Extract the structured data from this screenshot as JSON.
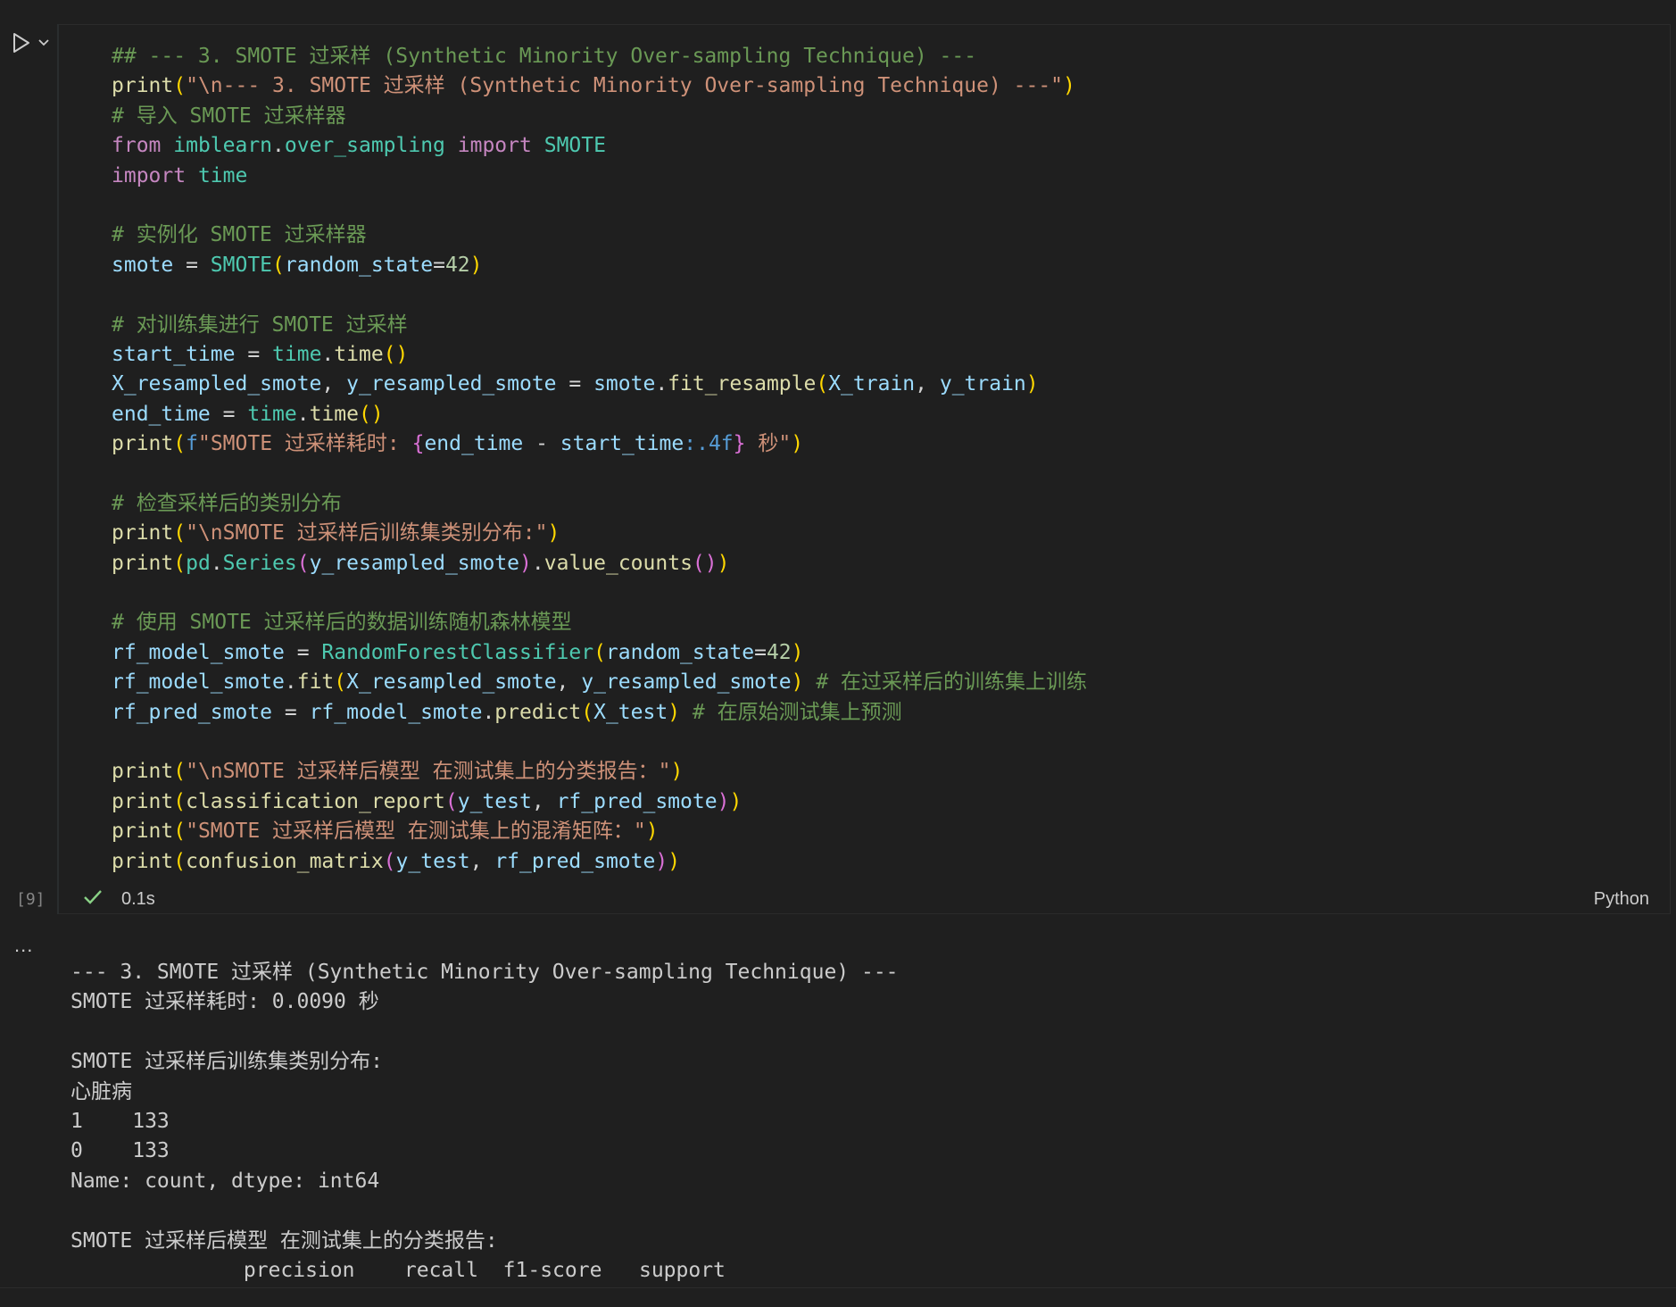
{
  "cell": {
    "execution_count": "[9]",
    "duration": "0.1s",
    "language": "Python",
    "code_lines": [
      [
        {
          "t": "## --- 3. SMOTE 过采样 (Synthetic Minority Over-sampling Technique) ---",
          "c": "cmt"
        }
      ],
      [
        {
          "t": "print",
          "c": "fn"
        },
        {
          "t": "(",
          "c": "p1"
        },
        {
          "t": "\"\\n--- 3. SMOTE 过采样 (Synthetic Minority Over-sampling Technique) ---\"",
          "c": "str"
        },
        {
          "t": ")",
          "c": "p1"
        }
      ],
      [
        {
          "t": "# 导入 SMOTE 过采样器",
          "c": "cmt"
        }
      ],
      [
        {
          "t": "from",
          "c": "kw"
        },
        {
          "t": " ",
          "c": "op"
        },
        {
          "t": "imblearn",
          "c": "cls"
        },
        {
          "t": ".",
          "c": "op"
        },
        {
          "t": "over_sampling",
          "c": "cls"
        },
        {
          "t": " ",
          "c": "op"
        },
        {
          "t": "import",
          "c": "kw"
        },
        {
          "t": " ",
          "c": "op"
        },
        {
          "t": "SMOTE",
          "c": "cls"
        }
      ],
      [
        {
          "t": "import",
          "c": "kw"
        },
        {
          "t": " ",
          "c": "op"
        },
        {
          "t": "time",
          "c": "cls"
        }
      ],
      [],
      [
        {
          "t": "# 实例化 SMOTE 过采样器",
          "c": "cmt"
        }
      ],
      [
        {
          "t": "smote",
          "c": "var"
        },
        {
          "t": " = ",
          "c": "op"
        },
        {
          "t": "SMOTE",
          "c": "cls"
        },
        {
          "t": "(",
          "c": "p1"
        },
        {
          "t": "random_state",
          "c": "var"
        },
        {
          "t": "=",
          "c": "op"
        },
        {
          "t": "42",
          "c": "num"
        },
        {
          "t": ")",
          "c": "p1"
        }
      ],
      [],
      [
        {
          "t": "# 对训练集进行 SMOTE 过采样",
          "c": "cmt"
        }
      ],
      [
        {
          "t": "start_time",
          "c": "var"
        },
        {
          "t": " = ",
          "c": "op"
        },
        {
          "t": "time",
          "c": "cls"
        },
        {
          "t": ".",
          "c": "op"
        },
        {
          "t": "time",
          "c": "fn"
        },
        {
          "t": "()",
          "c": "p1"
        }
      ],
      [
        {
          "t": "X_resampled_smote",
          "c": "var"
        },
        {
          "t": ", ",
          "c": "op"
        },
        {
          "t": "y_resampled_smote",
          "c": "var"
        },
        {
          "t": " = ",
          "c": "op"
        },
        {
          "t": "smote",
          "c": "var"
        },
        {
          "t": ".",
          "c": "op"
        },
        {
          "t": "fit_resample",
          "c": "fn"
        },
        {
          "t": "(",
          "c": "p1"
        },
        {
          "t": "X_train",
          "c": "var"
        },
        {
          "t": ", ",
          "c": "op"
        },
        {
          "t": "y_train",
          "c": "var"
        },
        {
          "t": ")",
          "c": "p1"
        }
      ],
      [
        {
          "t": "end_time",
          "c": "var"
        },
        {
          "t": " = ",
          "c": "op"
        },
        {
          "t": "time",
          "c": "cls"
        },
        {
          "t": ".",
          "c": "op"
        },
        {
          "t": "time",
          "c": "fn"
        },
        {
          "t": "()",
          "c": "p1"
        }
      ],
      [
        {
          "t": "print",
          "c": "fn"
        },
        {
          "t": "(",
          "c": "p1"
        },
        {
          "t": "f",
          "c": "br"
        },
        {
          "t": "\"SMOTE 过采样耗时: ",
          "c": "str"
        },
        {
          "t": "{",
          "c": "p2"
        },
        {
          "t": "end_time",
          "c": "var"
        },
        {
          "t": " - ",
          "c": "op"
        },
        {
          "t": "start_time",
          "c": "var"
        },
        {
          "t": ":.4f",
          "c": "br"
        },
        {
          "t": "}",
          "c": "p2"
        },
        {
          "t": " 秒\"",
          "c": "str"
        },
        {
          "t": ")",
          "c": "p1"
        }
      ],
      [],
      [
        {
          "t": "# 检查采样后的类别分布",
          "c": "cmt"
        }
      ],
      [
        {
          "t": "print",
          "c": "fn"
        },
        {
          "t": "(",
          "c": "p1"
        },
        {
          "t": "\"\\nSMOTE 过采样后训练集类别分布:\"",
          "c": "str"
        },
        {
          "t": ")",
          "c": "p1"
        }
      ],
      [
        {
          "t": "print",
          "c": "fn"
        },
        {
          "t": "(",
          "c": "p1"
        },
        {
          "t": "pd",
          "c": "cls"
        },
        {
          "t": ".",
          "c": "op"
        },
        {
          "t": "Series",
          "c": "cls"
        },
        {
          "t": "(",
          "c": "p2"
        },
        {
          "t": "y_resampled_smote",
          "c": "var"
        },
        {
          "t": ")",
          "c": "p2"
        },
        {
          "t": ".",
          "c": "op"
        },
        {
          "t": "value_counts",
          "c": "fn"
        },
        {
          "t": "()",
          "c": "p2"
        },
        {
          "t": ")",
          "c": "p1"
        }
      ],
      [],
      [
        {
          "t": "# 使用 SMOTE 过采样后的数据训练随机森林模型",
          "c": "cmt"
        }
      ],
      [
        {
          "t": "rf_model_smote",
          "c": "var"
        },
        {
          "t": " = ",
          "c": "op"
        },
        {
          "t": "RandomForestClassifier",
          "c": "cls"
        },
        {
          "t": "(",
          "c": "p1"
        },
        {
          "t": "random_state",
          "c": "var"
        },
        {
          "t": "=",
          "c": "op"
        },
        {
          "t": "42",
          "c": "num"
        },
        {
          "t": ")",
          "c": "p1"
        }
      ],
      [
        {
          "t": "rf_model_smote",
          "c": "var"
        },
        {
          "t": ".",
          "c": "op"
        },
        {
          "t": "fit",
          "c": "fn"
        },
        {
          "t": "(",
          "c": "p1"
        },
        {
          "t": "X_resampled_smote",
          "c": "var"
        },
        {
          "t": ", ",
          "c": "op"
        },
        {
          "t": "y_resampled_smote",
          "c": "var"
        },
        {
          "t": ")",
          "c": "p1"
        },
        {
          "t": " # 在过采样后的训练集上训练",
          "c": "cmt"
        }
      ],
      [
        {
          "t": "rf_pred_smote",
          "c": "var"
        },
        {
          "t": " = ",
          "c": "op"
        },
        {
          "t": "rf_model_smote",
          "c": "var"
        },
        {
          "t": ".",
          "c": "op"
        },
        {
          "t": "predict",
          "c": "fn"
        },
        {
          "t": "(",
          "c": "p1"
        },
        {
          "t": "X_test",
          "c": "var"
        },
        {
          "t": ")",
          "c": "p1"
        },
        {
          "t": " # 在原始测试集上预测",
          "c": "cmt"
        }
      ],
      [],
      [
        {
          "t": "print",
          "c": "fn"
        },
        {
          "t": "(",
          "c": "p1"
        },
        {
          "t": "\"\\nSMOTE 过采样后模型 在测试集上的分类报告：\"",
          "c": "str"
        },
        {
          "t": ")",
          "c": "p1"
        }
      ],
      [
        {
          "t": "print",
          "c": "fn"
        },
        {
          "t": "(",
          "c": "p1"
        },
        {
          "t": "classification_report",
          "c": "fn"
        },
        {
          "t": "(",
          "c": "p2"
        },
        {
          "t": "y_test",
          "c": "var"
        },
        {
          "t": ", ",
          "c": "op"
        },
        {
          "t": "rf_pred_smote",
          "c": "var"
        },
        {
          "t": ")",
          "c": "p2"
        },
        {
          "t": ")",
          "c": "p1"
        }
      ],
      [
        {
          "t": "print",
          "c": "fn"
        },
        {
          "t": "(",
          "c": "p1"
        },
        {
          "t": "\"SMOTE 过采样后模型 在测试集上的混淆矩阵：\"",
          "c": "str"
        },
        {
          "t": ")",
          "c": "p1"
        }
      ],
      [
        {
          "t": "print",
          "c": "fn"
        },
        {
          "t": "(",
          "c": "p1"
        },
        {
          "t": "confusion_matrix",
          "c": "fn"
        },
        {
          "t": "(",
          "c": "p2"
        },
        {
          "t": "y_test",
          "c": "var"
        },
        {
          "t": ", ",
          "c": "op"
        },
        {
          "t": "rf_pred_smote",
          "c": "var"
        },
        {
          "t": ")",
          "c": "p2"
        },
        {
          "t": ")",
          "c": "p1"
        }
      ]
    ]
  },
  "output": {
    "more_label": "...",
    "lines": [
      "--- 3. SMOTE 过采样 (Synthetic Minority Over-sampling Technique) ---",
      "SMOTE 过采样耗时: 0.0090 秒",
      "",
      "SMOTE 过采样后训练集类别分布:",
      "心脏病",
      "1    133",
      "0    133",
      "Name: count, dtype: int64",
      "",
      "SMOTE 过采样后模型 在测试集上的分类报告:",
      "              precision    recall  f1-score   support"
    ]
  },
  "icons": {
    "run": "play-icon",
    "run_options": "chevron-down-icon",
    "status": "check-icon"
  },
  "colors": {
    "background": "#1f1f1f",
    "success_check": "#89d185"
  }
}
